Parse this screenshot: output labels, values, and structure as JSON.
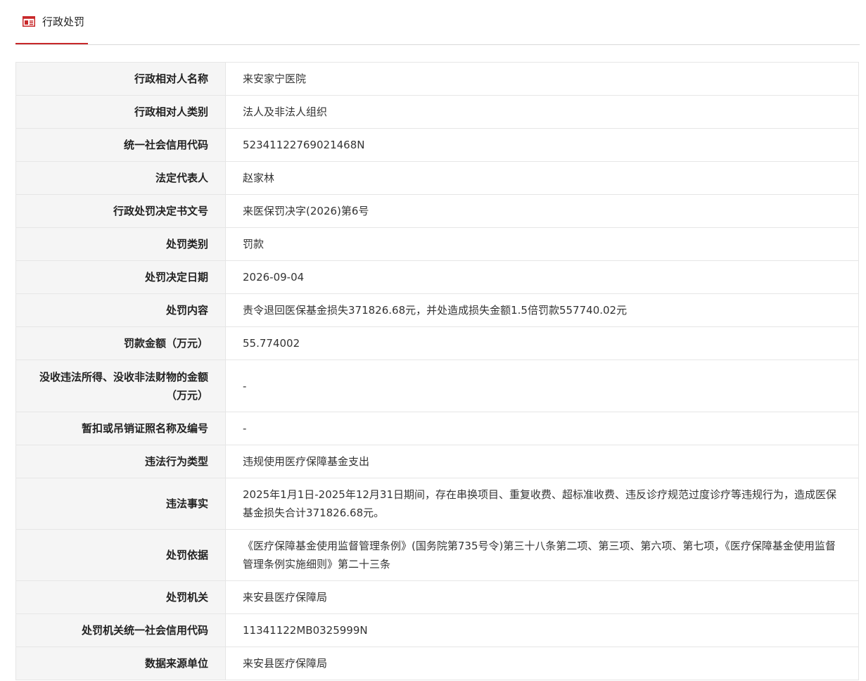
{
  "tab": {
    "label": "行政处罚",
    "icon": "document-icon",
    "accent_color": "#c8282a"
  },
  "rows": [
    {
      "label": "行政相对人名称",
      "value": "来安家宁医院"
    },
    {
      "label": "行政相对人类别",
      "value": "法人及非法人组织"
    },
    {
      "label": "统一社会信用代码",
      "value": "52341122769021468N"
    },
    {
      "label": "法定代表人",
      "value": "赵家林"
    },
    {
      "label": "行政处罚决定书文号",
      "value": "来医保罚决字(2026)第6号"
    },
    {
      "label": "处罚类别",
      "value": "罚款"
    },
    {
      "label": "处罚决定日期",
      "value": "2026-09-04"
    },
    {
      "label": "处罚内容",
      "value": "责令退回医保基金损失371826.68元，并处造成损失金额1.5倍罚款557740.02元"
    },
    {
      "label": "罚款金额（万元）",
      "value": "55.774002"
    },
    {
      "label": "没收违法所得、没收非法财物的金额（万元）",
      "value": "-"
    },
    {
      "label": "暂扣或吊销证照名称及编号",
      "value": "-"
    },
    {
      "label": "违法行为类型",
      "value": "违规使用医疗保障基金支出"
    },
    {
      "label": "违法事实",
      "value": "2025年1月1日-2025年12月31日期间，存在串换项目、重复收费、超标准收费、违反诊疗规范过度诊疗等违规行为，造成医保基金损失合计371826.68元。"
    },
    {
      "label": "处罚依据",
      "value": "《医疗保障基金使用监督管理条例》(国务院第735号令)第三十八条第二项、第三项、第六项、第七项，《医疗保障基金使用监督管理条例实施细则》第二十三条"
    },
    {
      "label": "处罚机关",
      "value": "来安县医疗保障局"
    },
    {
      "label": "处罚机关统一社会信用代码",
      "value": "11341122MB0325999N"
    },
    {
      "label": "数据来源单位",
      "value": "来安县医疗保障局"
    }
  ]
}
